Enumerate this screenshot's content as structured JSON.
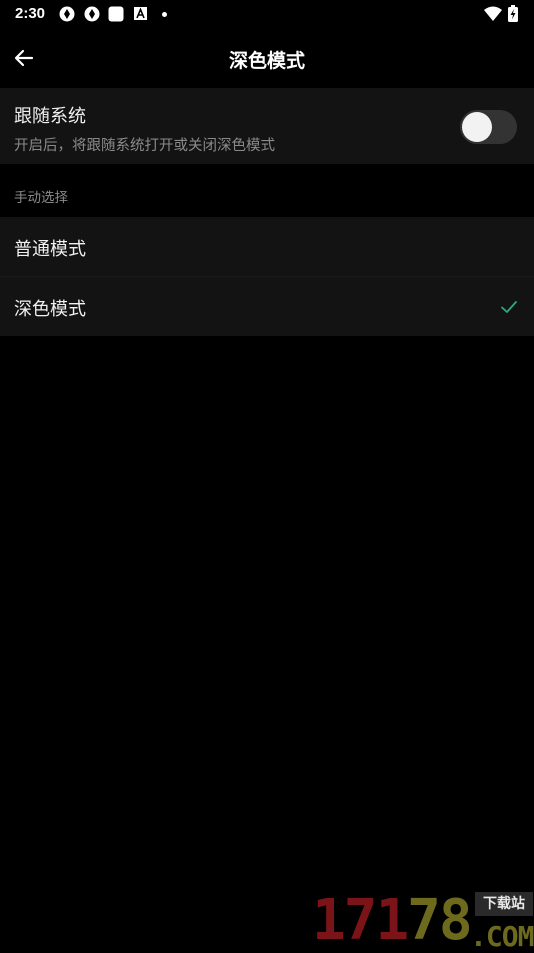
{
  "status_bar": {
    "time": "2:30",
    "icons": [
      "aperture-icon",
      "aperture-icon",
      "square-icon",
      "font-a-icon",
      "dot-icon",
      "wifi-icon",
      "battery-charging-icon"
    ]
  },
  "header": {
    "back_icon": "arrow-left-icon",
    "title": "深色模式"
  },
  "follow_system": {
    "title": "跟随系统",
    "description": "开启后，将跟随系统打开或关闭深色模式",
    "enabled": false
  },
  "manual": {
    "section_label": "手动选择",
    "options": [
      {
        "label": "普通模式",
        "selected": false
      },
      {
        "label": "深色模式",
        "selected": true
      }
    ]
  },
  "colors": {
    "background": "#000000",
    "row_background": "#131313",
    "secondary_text": "#8a8a8a",
    "check_color": "#2fa882"
  },
  "watermark": {
    "number_red": "17",
    "number_one": "1",
    "number_yellow": "78",
    "tag": "下载站",
    "domain": ".COM"
  }
}
